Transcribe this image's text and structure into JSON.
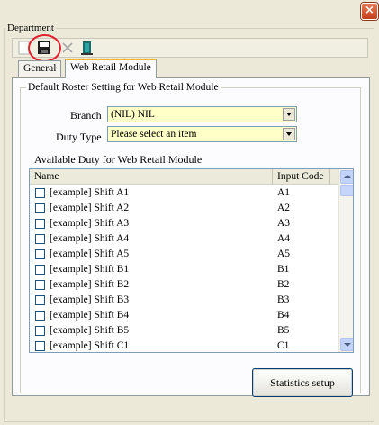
{
  "window": {
    "close_label": "×"
  },
  "department": {
    "legend": "Department"
  },
  "toolbar": {
    "buttons": [
      {
        "icon": "new-icon"
      },
      {
        "icon": "save-icon"
      },
      {
        "icon": "delete-icon"
      },
      {
        "icon": "exit-door-icon"
      }
    ]
  },
  "tabs": [
    {
      "label": "General",
      "active": false
    },
    {
      "label": "Web Retail Module",
      "active": true
    }
  ],
  "roster": {
    "legend": "Default Roster Setting for Web Retail Module",
    "branch_label": "Branch",
    "branch_value": "(NIL) NIL",
    "duty_type_label": "Duty Type",
    "duty_type_value": "Please select an item",
    "available_label": "Available Duty for Web Retail Module"
  },
  "list": {
    "columns": [
      "Name",
      "Input Code"
    ],
    "rows": [
      {
        "name": "[example] Shift A1",
        "code": "A1",
        "checked": false
      },
      {
        "name": "[example] Shift A2",
        "code": "A2",
        "checked": false
      },
      {
        "name": "[example] Shift A3",
        "code": "A3",
        "checked": false
      },
      {
        "name": "[example] Shift A4",
        "code": "A4",
        "checked": false
      },
      {
        "name": "[example] Shift A5",
        "code": "A5",
        "checked": false
      },
      {
        "name": "[example] Shift B1",
        "code": "B1",
        "checked": false
      },
      {
        "name": "[example] Shift B2",
        "code": "B2",
        "checked": false
      },
      {
        "name": "[example] Shift B3",
        "code": "B3",
        "checked": false
      },
      {
        "name": "[example] Shift B4",
        "code": "B4",
        "checked": false
      },
      {
        "name": "[example] Shift B5",
        "code": "B5",
        "checked": false
      },
      {
        "name": "[example] Shift C1",
        "code": "C1",
        "checked": false
      }
    ]
  },
  "statistics_button": {
    "label": "Statistics setup"
  },
  "colors": {
    "combo_bg": "#ffffc8",
    "highlight_circle": "#e0202c",
    "active_tab_accent": "#f7b32e"
  }
}
